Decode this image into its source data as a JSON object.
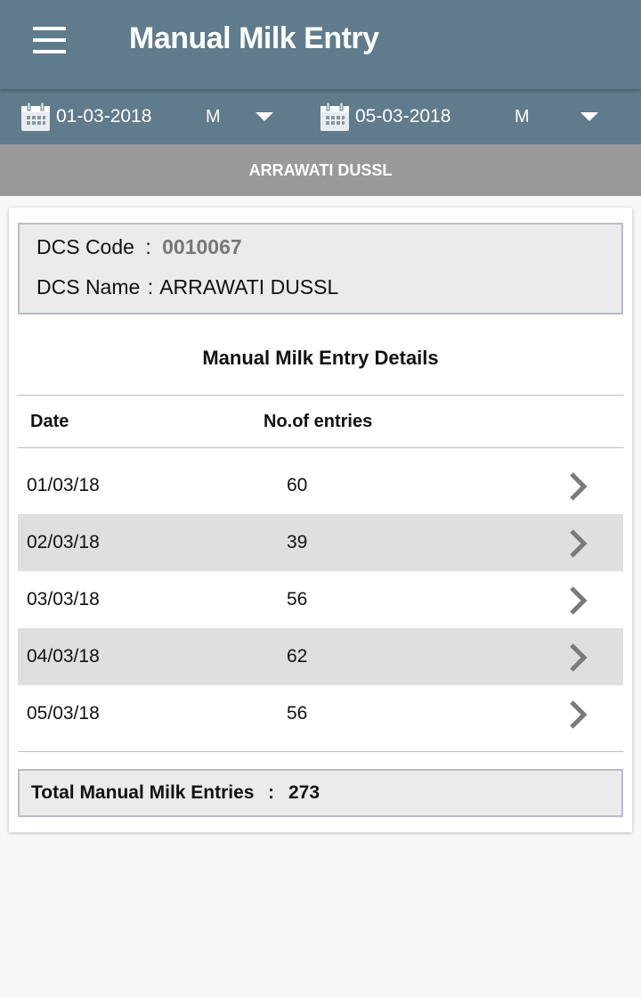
{
  "appbar": {
    "menu_icon": "hamburger-menu-icon",
    "title": "Manual Milk Entry"
  },
  "filters": {
    "from": {
      "icon": "calendar-icon",
      "date": "01-03-2018",
      "shift": "M"
    },
    "to": {
      "icon": "calendar-icon",
      "date": "05-03-2018",
      "shift": "M"
    },
    "dropdown_icon": "caret-down-icon"
  },
  "society_bar": {
    "name": "ARRAWATI DUSSL"
  },
  "info": {
    "code_label": "DCS Code",
    "code_sep": ":",
    "code_value": "0010067",
    "name_label": "DCS Name",
    "name_sep": ":",
    "name_value": "ARRAWATI DUSSL"
  },
  "details": {
    "title": "Manual Milk Entry Details",
    "columns": [
      "Date",
      "No.of entries"
    ],
    "row_icon": "chevron-right-icon",
    "rows": [
      {
        "date": "01/03/18",
        "count": "60"
      },
      {
        "date": "02/03/18",
        "count": "39"
      },
      {
        "date": "03/03/18",
        "count": "56"
      },
      {
        "date": "04/03/18",
        "count": "62"
      },
      {
        "date": "05/03/18",
        "count": "56"
      }
    ]
  },
  "total": {
    "label": "Total Manual Milk Entries",
    "sep": ":",
    "value": "273"
  },
  "colors": {
    "appbar": "#5f7b8c",
    "society_bar": "#999999",
    "info_box": "#ebebeb",
    "alt_row": "#dfdfdf",
    "code_value": "#777777",
    "chevron": "#7a7a7a"
  }
}
